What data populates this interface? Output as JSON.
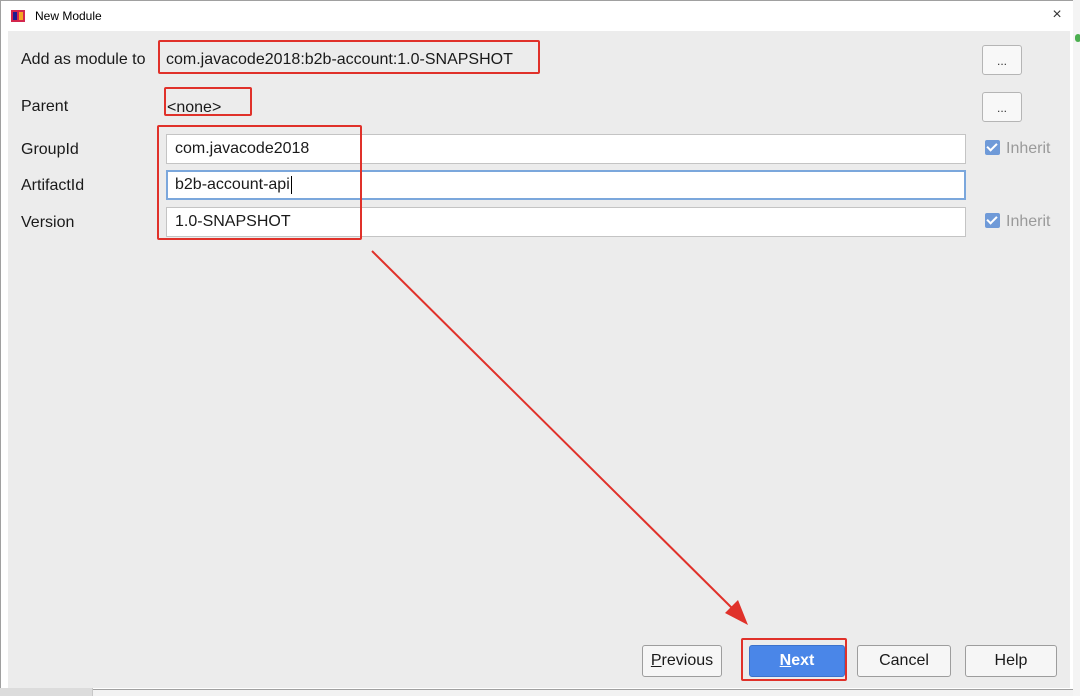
{
  "window": {
    "title": "New Module",
    "close_glyph": "×"
  },
  "form": {
    "add_as_module_label": "Add as module to",
    "add_as_module_value": "com.javacode2018:b2b-account:1.0-SNAPSHOT",
    "parent_label": "Parent",
    "parent_value": "<none>",
    "group_id_label": "GroupId",
    "group_id_value": "com.javacode2018",
    "artifact_id_label": "ArtifactId",
    "artifact_id_value": "b2b-account-api",
    "version_label": "Version",
    "version_value": "1.0-SNAPSHOT",
    "browse_label": "...",
    "inherit_label": "Inherit",
    "group_inherit_checked": true,
    "version_inherit_checked": true
  },
  "buttons": {
    "previous_mnemonic": "P",
    "previous_rest": "revious",
    "next_mnemonic": "N",
    "next_rest": "ext",
    "cancel": "Cancel",
    "help": "Help"
  },
  "colors": {
    "annotation": "#e0312a",
    "primary": "#4a86e8",
    "checkbox": "#6f9ad8"
  },
  "icons": {
    "app": "intellij-app-icon",
    "close": "close-icon",
    "checkbox": "checkbox-checked-icon",
    "arrow": "annotation-arrow"
  }
}
